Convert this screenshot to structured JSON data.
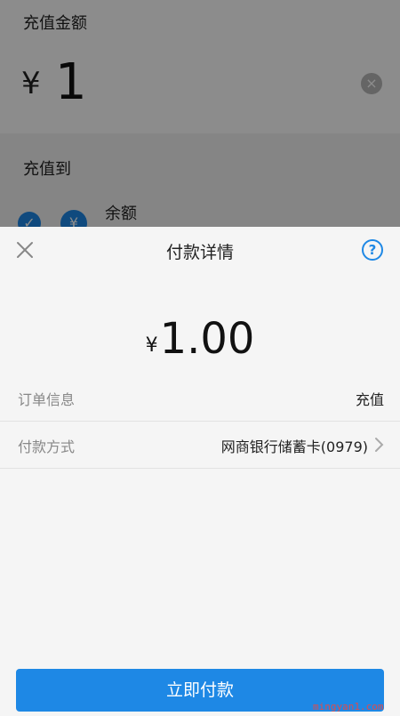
{
  "background": {
    "amount_label": "充值金额",
    "currency": "¥",
    "amount": "1",
    "clear_icon": "close-circle-icon",
    "recharge_to_label": "充值到",
    "option_label": "余额"
  },
  "sheet": {
    "title": "付款详情",
    "close_icon": "close-icon",
    "help_icon": "help-icon",
    "currency": "¥",
    "amount": "1.00",
    "order_label": "订单信息",
    "order_value": "充值",
    "payment_label": "付款方式",
    "payment_value": "网商银行储蓄卡(0979)",
    "pay_button": "立即付款"
  },
  "watermark": "mingyan1.com",
  "colors": {
    "accent": "#1e88e5"
  }
}
